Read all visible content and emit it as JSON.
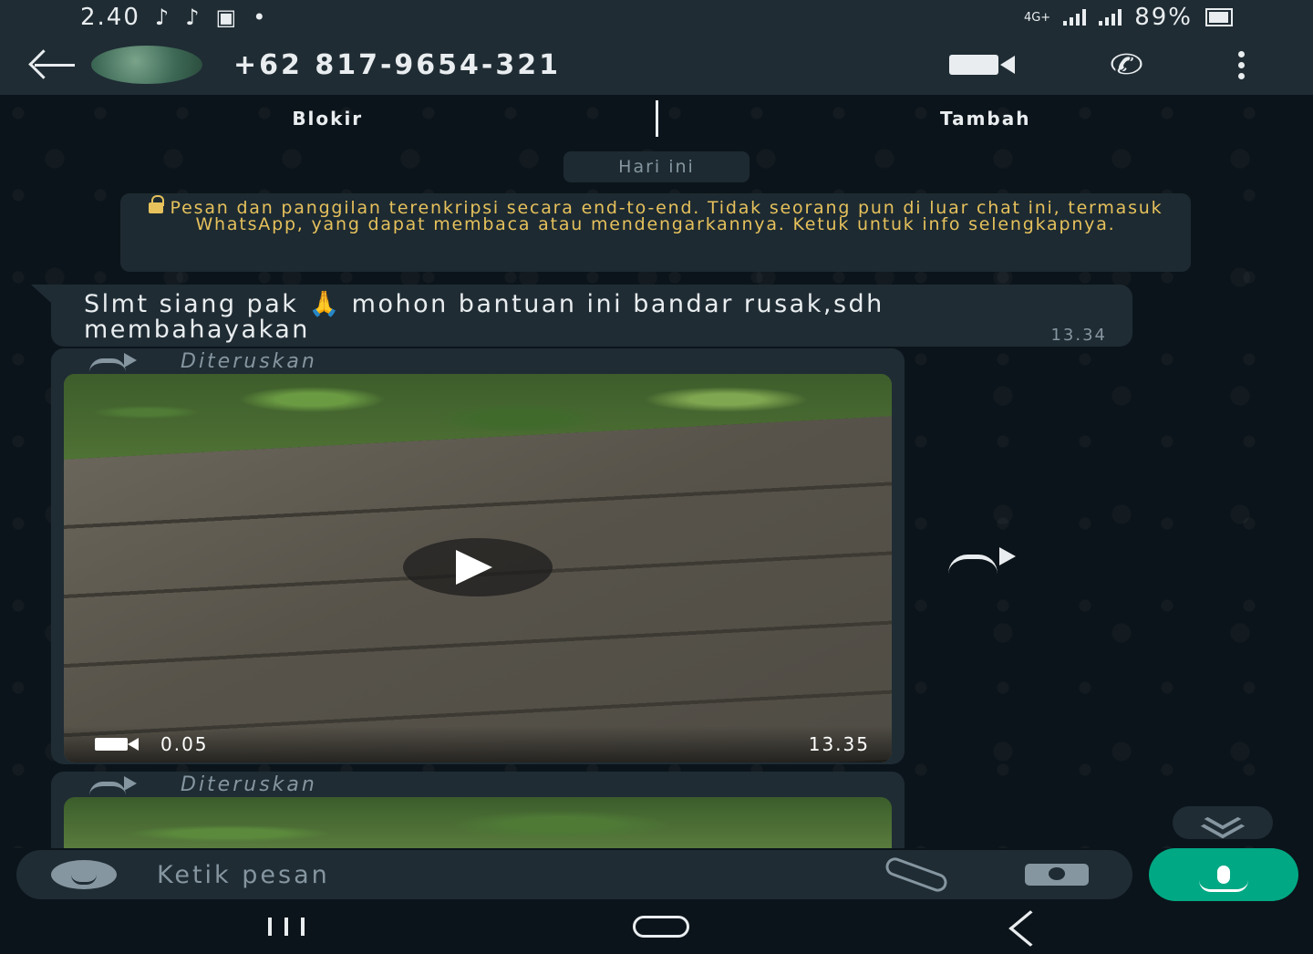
{
  "status_bar": {
    "time": "2.40",
    "network": "4G+",
    "battery": "89%",
    "notification_icons": [
      "tiktok-icon",
      "tiktok-icon",
      "gallery-icon",
      "dot-icon"
    ]
  },
  "header": {
    "contact_name": "+62 817-9654-321",
    "icons": [
      "back-arrow-icon",
      "avatar",
      "video-call-icon",
      "phone-icon",
      "more-vert-icon"
    ]
  },
  "action_bar": {
    "block_label": "Blokir",
    "add_label": "Tambah"
  },
  "chat": {
    "date_chip": "Hari ini",
    "encryption_notice": "Pesan dan panggilan terenkripsi secara end-to-end. Tidak seorang pun di luar chat ini, termasuk WhatsApp, yang dapat membaca atau mendengarkannya. Ketuk untuk info selengkapnya.",
    "messages": [
      {
        "type": "text",
        "text": "Slmt siang pak 🙏 mohon bantuan ini bandar rusak,sdh membahayakan",
        "time": "13.34"
      },
      {
        "type": "video",
        "forwarded_label": "Diteruskan",
        "duration": "0.05",
        "time": "13.35"
      },
      {
        "type": "video",
        "forwarded_label": "Diteruskan"
      }
    ]
  },
  "composer": {
    "placeholder": "Ketik pesan"
  },
  "colors": {
    "background": "#0b141a",
    "bubble": "#1f2c34",
    "accent": "#00a884",
    "notice_text": "#e6c15c"
  }
}
